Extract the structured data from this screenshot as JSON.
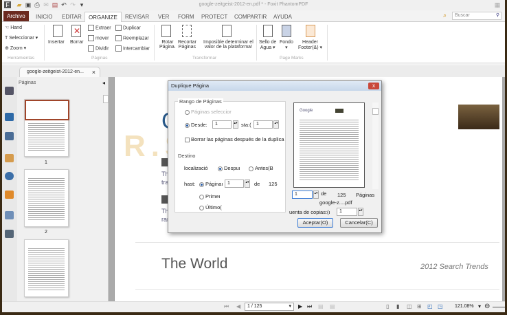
{
  "window": {
    "title": "google-zeitgeist-2012-en.pdf * - Foxit PhantomPDF"
  },
  "tabs": [
    "Archivo",
    "INICIO",
    "EDITAR",
    "ORGANIZE",
    "REVISAR",
    "VER",
    "FORM",
    "PROTECT",
    "COMPARTIR",
    "AYUDA"
  ],
  "search": {
    "placeholder": "Buscar"
  },
  "ribbon": {
    "herramientas": {
      "hand": "Hand",
      "select": "Seleccionar",
      "zoom": "Zoom",
      "group": "Herramientas"
    },
    "paginas": {
      "insert": "Insertar",
      "delete": "Borrar",
      "extract": "Extraer",
      "move": "mover",
      "split": "Dividir",
      "duplicate": "Duplicar",
      "replace": "Reemplazar",
      "swap": "Intercambiar",
      "group": "Páginas"
    },
    "transformar": {
      "rotate1": "Rotar",
      "rotate2": "Página.",
      "crop1": "Recortar",
      "crop2": "Páginas",
      "imp1": "Imposible determinar el",
      "imp2": "valor de la plataforma!",
      "group": "Transformar"
    },
    "pagemarks": {
      "wm1": "Sello de",
      "wm2": "Agua",
      "bg": "Fondo",
      "hf1": "Header",
      "hf2": "Footer(&)",
      "group": "Page Marks"
    }
  },
  "doc_tab": "google-zeitgeist-2012-en...",
  "panel": {
    "title": "Páginas",
    "thumbs": [
      "1",
      "2"
    ]
  },
  "page": {
    "heading": "The World",
    "subheading": "2012 Search Trends",
    "snip1a": "The",
    "snip1b": "trav",
    "snip2a": "The",
    "snip2b": "ran"
  },
  "dialog": {
    "title": "Duplique Página",
    "close": "x",
    "range_label": "Rango de Páginas",
    "selected": "Páginas seleccior",
    "from": "Desde:",
    "from_val": "1",
    "to": "sta:(",
    "to_val": "1",
    "delete_after": "Borrar las páginas después de la duplica",
    "dest_label": "Destino",
    "location": "localizació",
    "after": "Despuı",
    "before": "Antes(B",
    "to_label": "hast:",
    "page": "Páginaı",
    "page_val": "1",
    "of": "de",
    "total": "125",
    "first": "Primeı",
    "last": "Último(",
    "preview_page": "1",
    "preview_of": "de",
    "preview_total": "125",
    "preview_pages": "Páginas",
    "file": "google-z....pdf",
    "copies_label": "uenta de copias:(ι",
    "copies_val": "1",
    "ok": "Aceptar(O)",
    "cancel": "Cancelar(C)"
  },
  "status": {
    "page": "1 / 125",
    "zoom": "121.08%"
  },
  "watermark": "R.SLOAD.SC"
}
